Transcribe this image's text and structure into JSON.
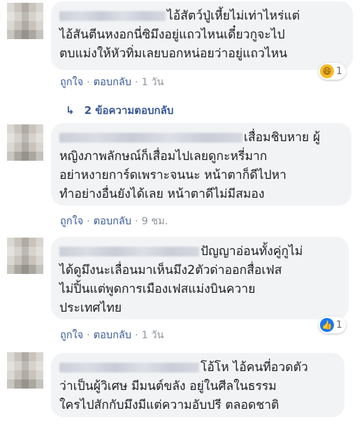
{
  "comments": [
    {
      "text_first": "ไอ้สัตว์ปู่เหี้ยไม่เท่าไหร่แต่",
      "text_rest": "ไอ้สันตีนหงอกนี่ซิมึงอยู่แถวไหนเดี๋ยวกูจะไป\nตบแม่งให้หัวทิ่มเลยบอกหน่อยว่าอยู่แถวไหน",
      "like_label": "ถูกใจ",
      "reply_label": "ตอบกลับ",
      "time": "1 วัน",
      "reaction_icon": "haha-reaction-icon",
      "reaction_count": "1"
    },
    {
      "text_first": "เสื่อมชิบหาย ผู้",
      "text_rest": "หญิงภาพลักษณ์ก็เสื่อมไปเลยดูกะหรี่มาก\nอย่าหงายการ์ดเพราะจนนะ หน้าตาก็ดีไปหา\nทำอย่างอื่นยังได้เลย หน้าตาดีไม่มีสมอง",
      "like_label": "ถูกใจ",
      "reply_label": "ตอบกลับ",
      "time": "9 ชม."
    },
    {
      "text_first": "ปัญญาอ่อนทั้งคู่กูไม่",
      "text_rest": "ได้ดูมึงนะเลื่อนมาเห็นมึง2ตัวด่าออกสื่อเฟส\nไม่ปิ้นแต่พูดการเมืองเฟสแม่งบินควาย\nประเทศไทย",
      "like_label": "ถูกใจ",
      "reply_label": "ตอบกลับ",
      "time": "1 วัน",
      "reaction_icon": "like-reaction-icon",
      "reaction_count": "1"
    },
    {
      "text_first": "โอ้โห ไอ้คนที่อวดตัว",
      "text_rest": "ว่าเป็นผู้วิเศษ มีมนต์ขลัง อยู่ในศีลในธรรม\nใครไปสักกับมึงมีแต่ความอับปรี ตลอดชาติ"
    }
  ],
  "replies_link": "2 ข้อความตอบกลับ",
  "separator": "·",
  "colors": {
    "bubble": "#f2f3f5",
    "link": "#385898",
    "time": "#90949c",
    "text": "#1c1e21"
  }
}
